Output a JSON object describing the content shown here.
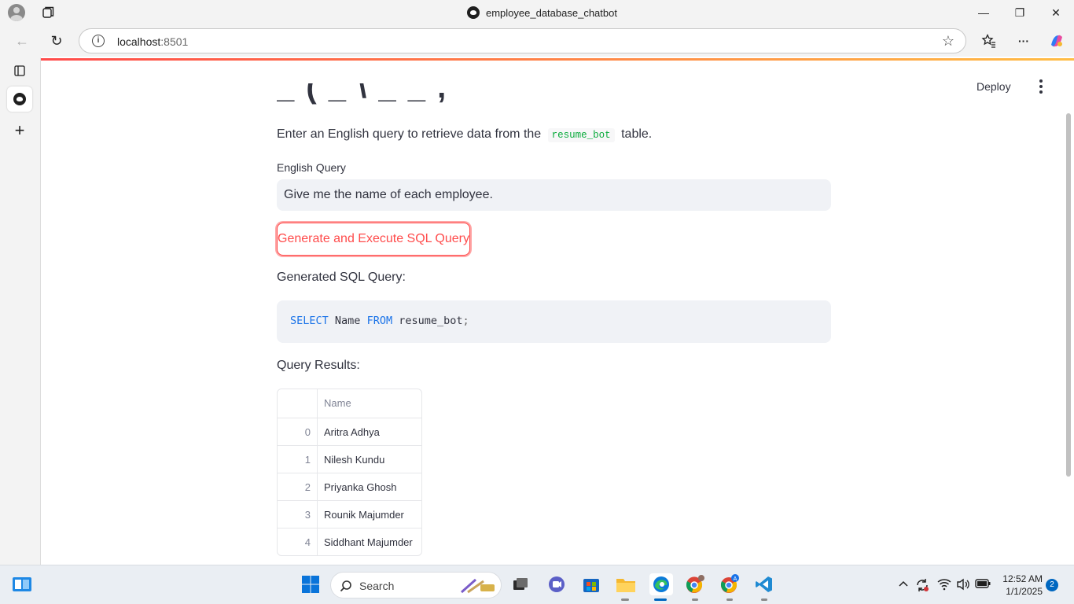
{
  "window": {
    "title": "employee_database_chatbot",
    "minimize": "—",
    "restore": "❐",
    "close": "✕"
  },
  "browser": {
    "url_host": "localhost",
    "url_port": ":8501",
    "back": "←",
    "reload": "↻",
    "star": "☆",
    "favorites": "☆≡",
    "more": "···"
  },
  "app_header": {
    "deploy_label": "Deploy"
  },
  "page_title_cut": "_ ( _ \\ _ _ ,",
  "description": {
    "before": "Enter an English query to retrieve data from the",
    "table_name": "resume_bot",
    "after": "table."
  },
  "query_field": {
    "label": "English Query",
    "value": "Give me the name of each employee."
  },
  "generate_button": "Generate and Execute SQL Query",
  "generated_sql": {
    "label": "Generated SQL Query:",
    "kw_select": "SELECT",
    "col": "Name",
    "kw_from": "FROM",
    "table": "resume_bot",
    "semicolon": ";"
  },
  "results": {
    "label": "Query Results:",
    "column": "Name",
    "rows": [
      {
        "index": "0",
        "name": "Aritra Adhya"
      },
      {
        "index": "1",
        "name": "Nilesh Kundu"
      },
      {
        "index": "2",
        "name": "Priyanka Ghosh"
      },
      {
        "index": "3",
        "name": "Rounik Majumder"
      },
      {
        "index": "4",
        "name": "Siddhant Majumder"
      }
    ]
  },
  "taskbar": {
    "search_placeholder": "Search",
    "time": "12:52 AM",
    "date": "1/1/2025",
    "notification_count": "2"
  },
  "colors": {
    "accent": "#ff4b4b",
    "sql_keyword": "#1a73e8",
    "inline_code": "#09ab3b"
  }
}
